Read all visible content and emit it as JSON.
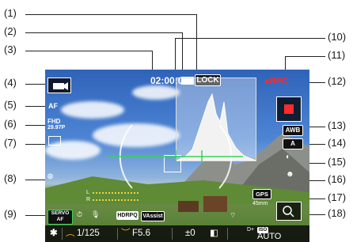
{
  "callouts": [
    "(1)",
    "(2)",
    "(3)",
    "(4)",
    "(5)",
    "(6)",
    "(7)",
    "(8)",
    "(9)",
    "(10)",
    "(11)",
    "(12)",
    "(13)",
    "(14)",
    "(15)",
    "(16)",
    "(17)",
    "(18)"
  ],
  "screen": {
    "timecode": "02:00:00",
    "lock_label": "LOCK",
    "rec_label": "●REC",
    "af_mode": "AF",
    "movie_size_top": "FHD",
    "movie_size_bottom": "29.97P",
    "audio_l": "L",
    "audio_r": "R",
    "servo_af": "SERVO AF",
    "hdr_label": "HDRPQ",
    "vassist_label": "VAssist",
    "wb_label": "AWB",
    "picture_style": "A",
    "gps_label": "GPS",
    "focal_length": "45mm",
    "shutter": "1/125",
    "aperture": "F5.6",
    "exposure_comp": "±0",
    "dplus": "D+",
    "iso_label": "ISO",
    "iso_value": "AUTO"
  },
  "colors": {
    "rec_red": "#ff2a2a",
    "focus_green": "#35d35a",
    "accent_orange": "#f3a21a"
  }
}
